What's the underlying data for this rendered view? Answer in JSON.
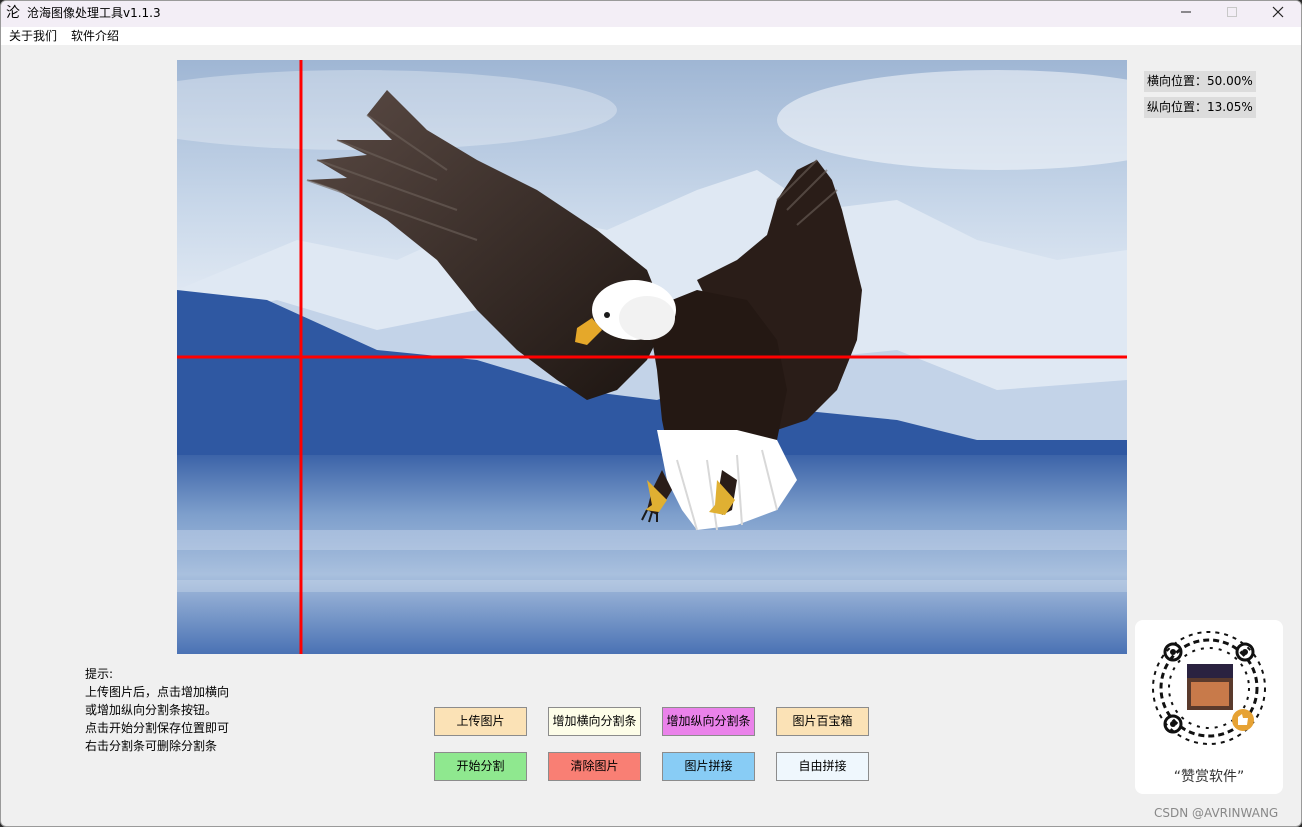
{
  "window": {
    "title": "沧海图像处理工具v1.1.3",
    "app_icon_glyph": "沦"
  },
  "menu": {
    "about": "关于我们",
    "intro": "软件介绍"
  },
  "positions": {
    "horizontal": "横向位置：50.00%",
    "vertical": "纵向位置：13.05%"
  },
  "split_lines": {
    "horizontal_ratio": 0.5,
    "vertical_ratio": 0.1305,
    "color": "#ff0000"
  },
  "hint": {
    "title": "提示:",
    "line1": "上传图片后，点击增加横向",
    "line2": "或增加纵向分割条按钮。",
    "line3": "点击开始分割保存位置即可",
    "line4": "右击分割条可删除分割条"
  },
  "buttons": {
    "upload": {
      "label": "上传图片",
      "color": "#fbe2b6"
    },
    "add_horizontal": {
      "label": "增加横向分割条",
      "color": "#fdfde8"
    },
    "add_vertical": {
      "label": "增加纵向分割条",
      "color": "#ea82ea"
    },
    "toolbox": {
      "label": "图片百宝箱",
      "color": "#fbe2b6"
    },
    "start_split": {
      "label": "开始分割",
      "color": "#8fe88f"
    },
    "clear": {
      "label": "清除图片",
      "color": "#f97f74"
    },
    "stitch": {
      "label": "图片拼接",
      "color": "#88ccf5"
    },
    "free_stitch": {
      "label": "自由拼接",
      "color": "#eff7fd"
    }
  },
  "donate": {
    "caption": "“赞赏软件”"
  },
  "watermark": "CSDN @AVRINWANG"
}
